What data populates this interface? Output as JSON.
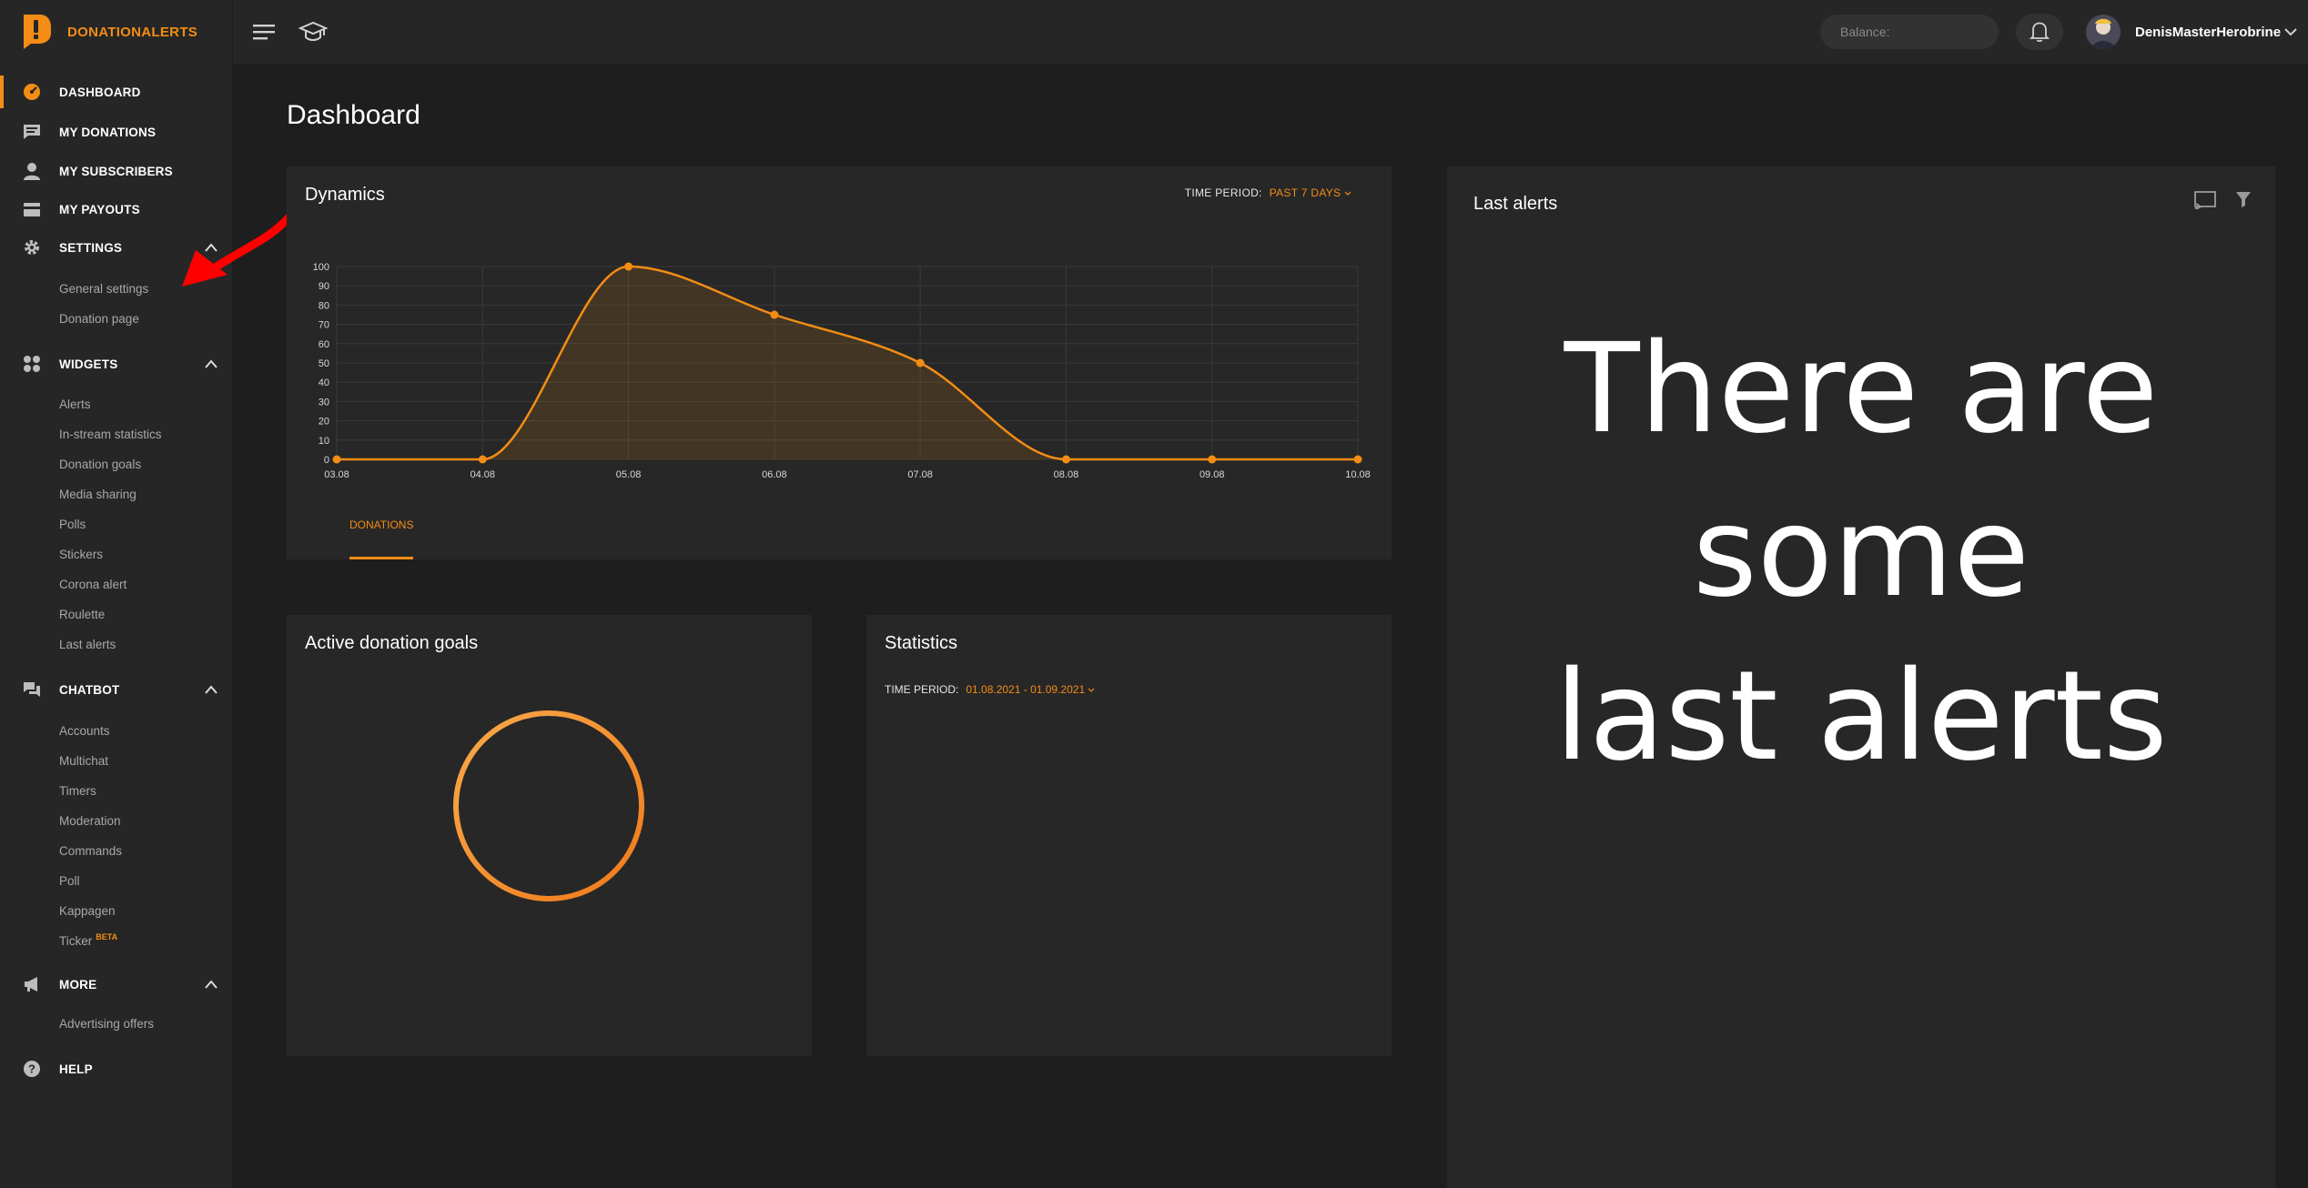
{
  "brand": {
    "name": "DONATIONALERTS",
    "accent": "#f38d15"
  },
  "sidebar": {
    "main": [
      {
        "label": "DASHBOARD",
        "icon": "dashboard-icon"
      },
      {
        "label": "MY DONATIONS",
        "icon": "chat-icon"
      },
      {
        "label": "MY SUBSCRIBERS",
        "icon": "person-icon"
      },
      {
        "label": "MY PAYOUTS",
        "icon": "wallet-icon"
      },
      {
        "label": "SETTINGS",
        "icon": "gear-icon"
      },
      {
        "label": "WIDGETS",
        "icon": "widgets-icon"
      },
      {
        "label": "CHATBOT",
        "icon": "chatbot-icon"
      },
      {
        "label": "MORE",
        "icon": "megaphone-icon"
      },
      {
        "label": "HELP",
        "icon": "help-icon"
      }
    ],
    "settings_items": [
      "General settings",
      "Donation page"
    ],
    "widgets_items": [
      "Alerts",
      "In-stream statistics",
      "Donation goals",
      "Media sharing",
      "Polls",
      "Stickers",
      "Corona alert",
      "Roulette",
      "Last alerts"
    ],
    "chatbot_items": [
      "Accounts",
      "Multichat",
      "Timers",
      "Moderation",
      "Commands",
      "Poll",
      "Kappagen",
      "Ticker"
    ],
    "chatbot_badge": "BETA",
    "more_items": [
      "Advertising offers"
    ]
  },
  "topbar": {
    "balance_placeholder": "Balance:",
    "username": "DenisMasterHerobrine"
  },
  "main": {
    "title": "Dashboard",
    "dynamics": {
      "title": "Dynamics",
      "time_period_label": "TIME PERIOD:",
      "time_period_value": "PAST 7 DAYS",
      "tab_label": "DONATIONS"
    },
    "goals": {
      "title": "Active donation goals"
    },
    "statistics": {
      "title": "Statistics",
      "time_period_label": "TIME PERIOD:",
      "time_period_value": "01.08.2021 - 01.09.2021"
    },
    "alerts": {
      "title": "Last alerts",
      "message_lines": [
        "There are",
        "some",
        "last alerts"
      ]
    }
  },
  "chart_data": {
    "type": "line",
    "categories": [
      "03.08",
      "04.08",
      "05.08",
      "06.08",
      "07.08",
      "08.08",
      "09.08",
      "10.08"
    ],
    "series": [
      {
        "values": [
          0,
          0,
          100,
          75,
          50,
          0,
          0,
          0
        ]
      }
    ],
    "yticks": [
      0,
      10,
      20,
      30,
      40,
      50,
      60,
      70,
      80,
      90,
      100
    ],
    "ylim": [
      0,
      100
    ],
    "color": "#f38d15",
    "grid": true
  }
}
